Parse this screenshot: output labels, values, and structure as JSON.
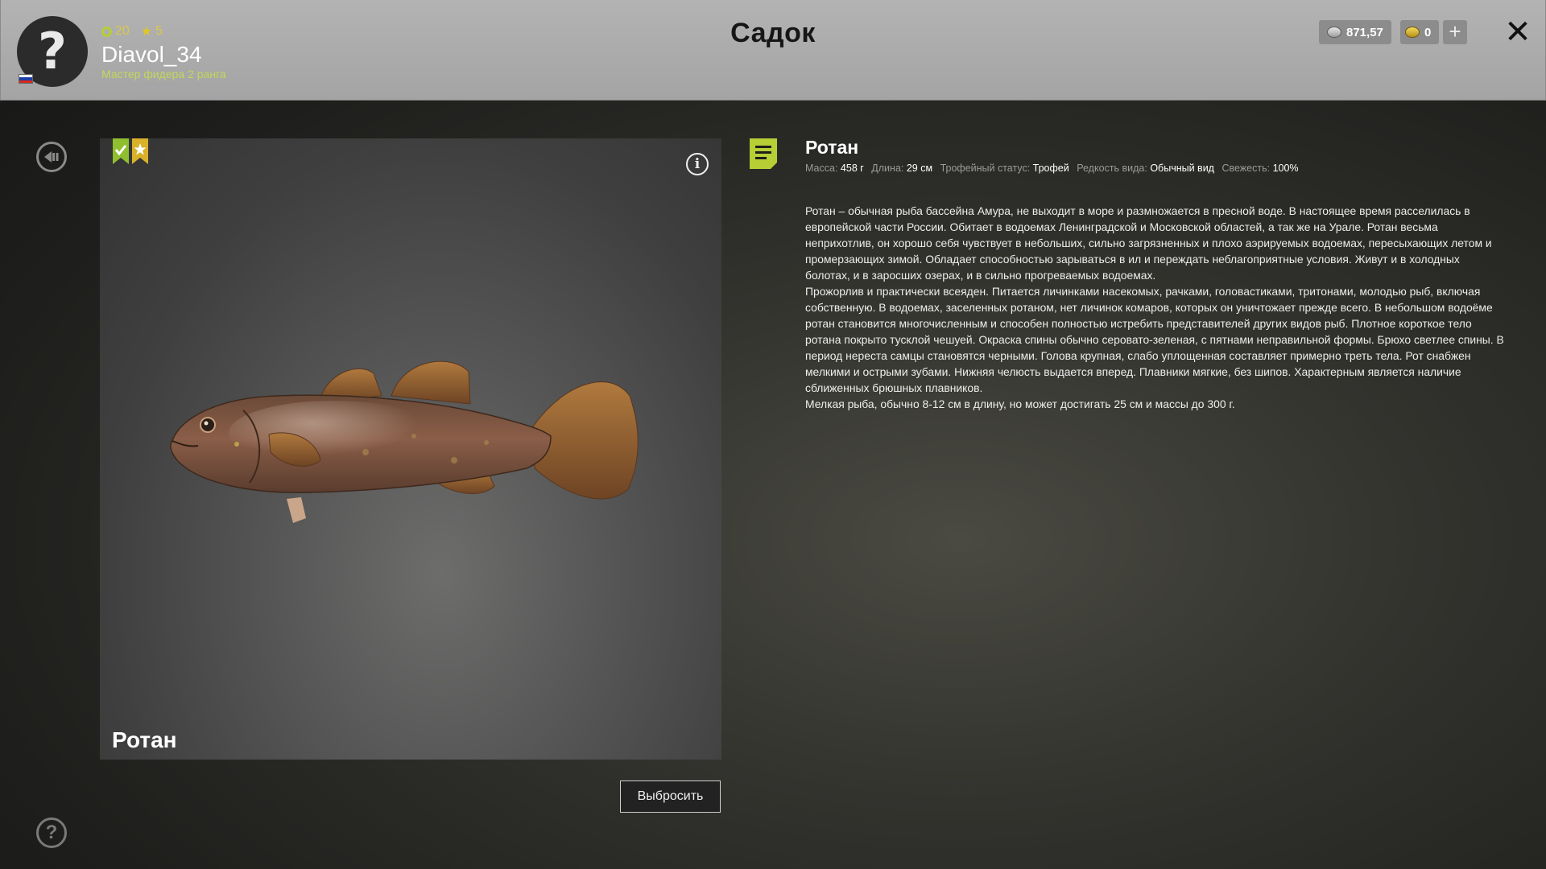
{
  "header": {
    "title": "Садок",
    "avatar_symbol": "?",
    "level": "20",
    "stars": "5",
    "username": "Diavol_34",
    "rank": "Мастер фидера 2 ранга",
    "silver": "871,57",
    "gold": "0",
    "plus_symbol": "+",
    "close_symbol": "✕"
  },
  "card": {
    "fish_name": "Ротан",
    "info_symbol": "i",
    "discard_label": "Выбросить"
  },
  "details": {
    "name": "Ротан",
    "mass_label": "Масса:",
    "mass_value": "458 г",
    "length_label": "Длина:",
    "length_value": "29 см",
    "trophy_label": "Трофейный статус:",
    "trophy_value": "Трофей",
    "rarity_label": "Редкость вида:",
    "rarity_value": "Обычный вид",
    "freshness_label": "Свежесть:",
    "freshness_value": "100%",
    "description": [
      "Ротан – обычная рыба бассейна Амура, не выходит в море и размножается в пресной воде. В настоящее время расселилась в европейской части России. Обитает в водоемах Ленинградской и Московской областей, а так же на Урале. Ротан весьма неприхотлив, он хорошо себя чувствует в небольших, сильно загрязненных и плохо аэрируемых водоемах, пересыхающих летом и промерзающих зимой. Обладает способностью зарываться в ил и переждать неблагоприятные условия. Живут и в холодных болотах, и в заросших озерах, и в сильно прогреваемых водоемах.",
      "Прожорлив и практически всеяден. Питается личинками насекомых, рачками, головастиками, тритонами, молодью рыб, включая собственную. В водоемах, заселенных ротаном, нет личинок комаров, которых он уничтожает прежде всего. В небольшом водоёме ротан становится многочисленным и способен полностью истребить представителей других видов рыб. Плотное короткое тело ротана покрыто тусклой чешуей. Окраска спины обычно серовато-зеленая, с пятнами неправильной формы. Брюхо светлее спины. В период нереста самцы становятся черными. Голова крупная, слабо уплощенная составляет примерно треть тела. Рот снабжен мелкими и острыми зубами. Нижняя челюсть выдается вперед. Плавники мягкие, без шипов. Характерным является наличие сближенных брюшных плавников.",
      "Мелкая рыба, обычно 8-12 см в длину, но может достигать 25 см и массы до 300 г."
    ]
  },
  "sidebar": {
    "help_symbol": "?"
  },
  "colors": {
    "accent_green": "#b5cf35",
    "accent_gold": "#e0c52a",
    "topbar_bg": "#aaaaaa",
    "panel_bg": "#2a2a28"
  },
  "icons": [
    "back-icon",
    "help-icon",
    "info-icon",
    "document-icon",
    "checkmark-bookmark-icon",
    "star-bookmark-icon",
    "silver-coin-icon",
    "gold-coin-icon",
    "close-icon",
    "plus-icon",
    "level-icon",
    "star-icon"
  ]
}
